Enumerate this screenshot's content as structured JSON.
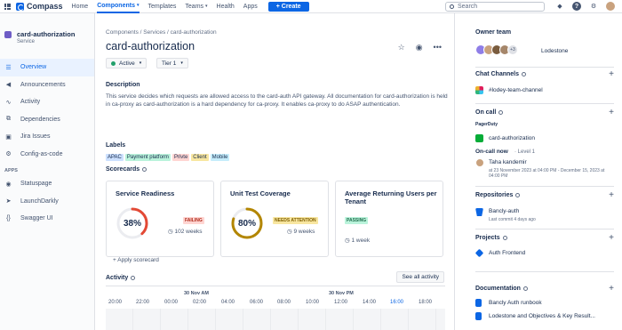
{
  "nav": {
    "logo_text": "Compass",
    "items": [
      "Home",
      "Components",
      "Templates",
      "Teams",
      "Health",
      "Apps"
    ],
    "create_label": "+ Create",
    "search_placeholder": "Search"
  },
  "sidebar": {
    "component_name": "card-authorization",
    "component_type": "Service",
    "items": [
      "Overview",
      "Announcements",
      "Activity",
      "Dependencies",
      "Jira Issues",
      "Config-as-code"
    ],
    "apps_label": "APPS",
    "apps": [
      "Statuspage",
      "LaunchDarkly",
      "Swagger UI"
    ]
  },
  "main": {
    "breadcrumb": "Components  /  Services  /  card-authorization",
    "title": "card-authorization",
    "status": "Active",
    "tier": "Tier 1",
    "description_heading": "Description",
    "description": "This service decides which requests are allowed access to the card-auth API gateway. All documentation for card-authorization is held in ca-proxy as card-authorization is a hard dependency for ca-proxy. It enables ca-proxy to do ASAP authentication.",
    "labels_heading": "Labels",
    "labels": [
      "APAC",
      "Payment platform",
      "Privte",
      "Client",
      "Mobile"
    ],
    "scorecards_heading": "Scorecards",
    "scorecards": [
      {
        "title": "Service Readiness",
        "value": "38%",
        "progress": 0.38,
        "status": "FAILING",
        "time": "102 weeks",
        "color": "#e34935"
      },
      {
        "title": "Unit Test Coverage",
        "value": "80%",
        "progress": 0.8,
        "status": "NEEDS ATTENTION",
        "time": "9 weeks",
        "color": "#b38600"
      },
      {
        "title": "Average Returning Users per Tenant",
        "value": "",
        "progress": null,
        "status": "PASSING",
        "time": "1 week",
        "color": "#22a06b"
      }
    ],
    "apply_scorecard": "+ Apply scorecard",
    "activity_heading": "Activity",
    "see_all": "See all activity",
    "activity_days": [
      "30 Nov AM",
      "30 Nov PM"
    ],
    "activity_hours": [
      "20:00",
      "22:00",
      "00:00",
      "02:00",
      "04:00",
      "06:00",
      "08:00",
      "10:00",
      "12:00",
      "14:00",
      "16:00",
      "18:00"
    ]
  },
  "right": {
    "owner_heading": "Owner team",
    "owner_more": "+3",
    "owner_team": "Lodestone",
    "chat_heading": "Chat Channels",
    "chat_channel": "#lodey-team-channel",
    "oncall_heading": "On call",
    "oncall_provider": "PagerDuty",
    "oncall_service": "card-authorization",
    "oncall_now": "On-call now",
    "oncall_level": "· Level 1",
    "oncall_person": "Taha kandemir",
    "oncall_time": "at 23 November 2023 at 04:00 PM - December 15, 2023 at 04:00 PM",
    "repos_heading": "Repositories",
    "repo_name": "Bancly-auth",
    "repo_commit": "Last commit 4 days ago",
    "projects_heading": "Projects",
    "project_name": "Auth Frontend",
    "docs_heading": "Documentation",
    "docs": [
      "Bancly Auth runbook",
      "Lodestone and Objectives & Key Result..."
    ]
  }
}
